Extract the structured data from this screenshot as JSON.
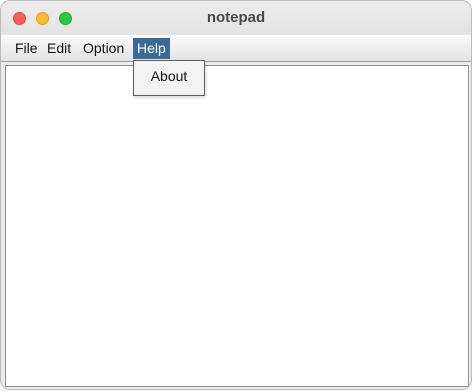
{
  "window": {
    "title": "notepad"
  },
  "traffic_lights": {
    "close_color": "#ff5f57",
    "minimize_color": "#febc2e",
    "maximize_color": "#28c840"
  },
  "menubar": {
    "items": [
      {
        "label": "File",
        "active": false
      },
      {
        "label": "Edit",
        "active": false
      },
      {
        "label": "Option",
        "active": false
      },
      {
        "label": "Help",
        "active": true
      }
    ],
    "active_color": "#3a6b95"
  },
  "help_menu": {
    "items": [
      {
        "label": "About"
      }
    ]
  },
  "editor": {
    "content": ""
  }
}
